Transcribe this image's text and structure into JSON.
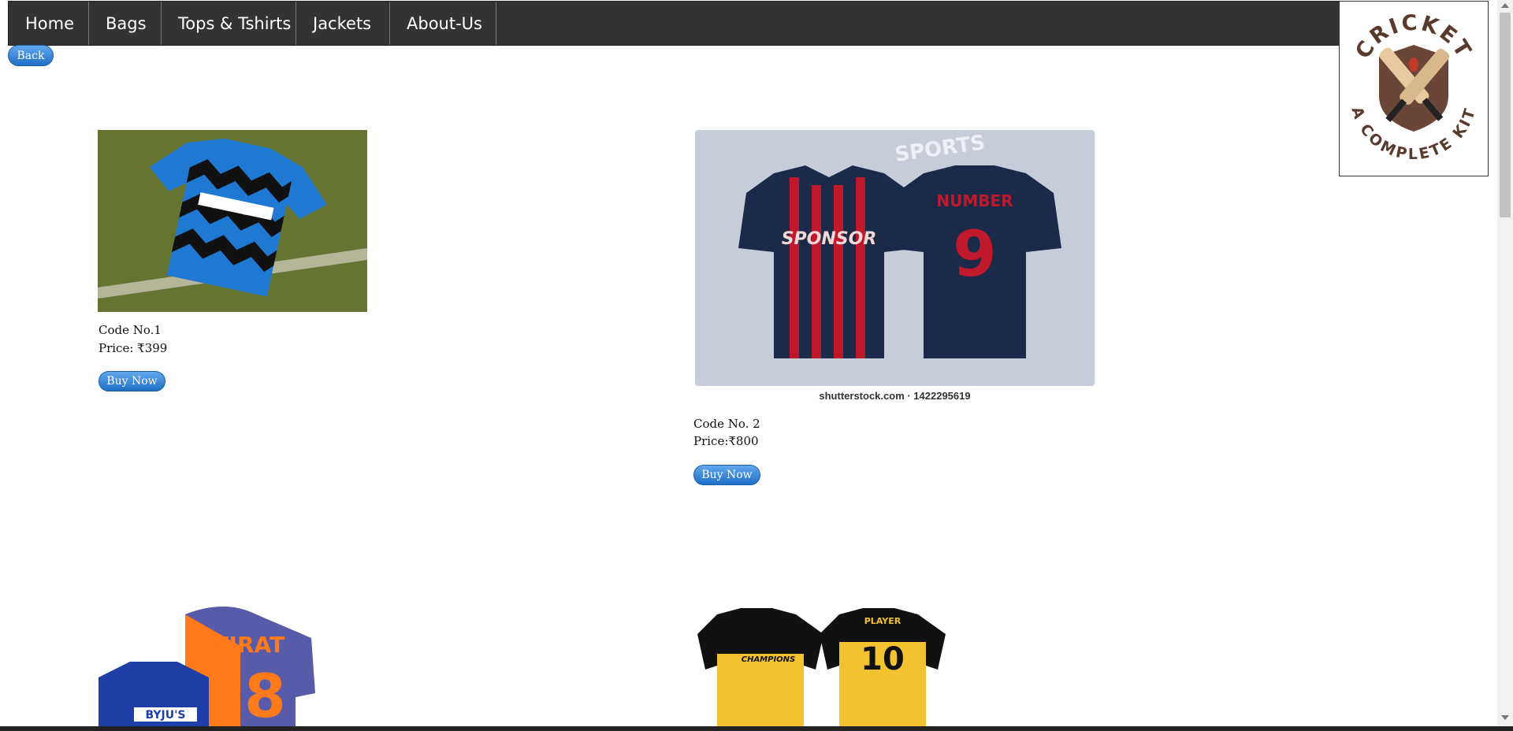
{
  "nav": {
    "items": [
      "Home",
      "Bags",
      "Tops & Tshirts",
      "Jackets",
      "About-Us"
    ]
  },
  "back_label": "Back",
  "logo": {
    "top_text": "CRICKET",
    "bottom_text": "A COMPLETE KIT",
    "colors": {
      "text": "#5a3a2e",
      "shield": "#6b4638",
      "bat": "#e8c9a0"
    }
  },
  "products": [
    {
      "code": "Code No.1",
      "price": "Price: ₹399",
      "buy_label": "Buy Now"
    },
    {
      "code": "Code No. 2",
      "price": "Price:₹800",
      "buy_label": "Buy Now",
      "image_caption": "shutterstock.com · 1422295619",
      "front_text": "SPONSOR",
      "back_text": "NUMBER",
      "back_number": "9",
      "watermark": "SPORTS"
    },
    {
      "image_text_name": "VIRAT",
      "image_text_number": "18",
      "image_sponsor": "BYJU'S"
    },
    {
      "image_text_front": "CHAMPIONS",
      "image_text_back_name": "PLAYER",
      "image_text_back_number": "10"
    }
  ]
}
